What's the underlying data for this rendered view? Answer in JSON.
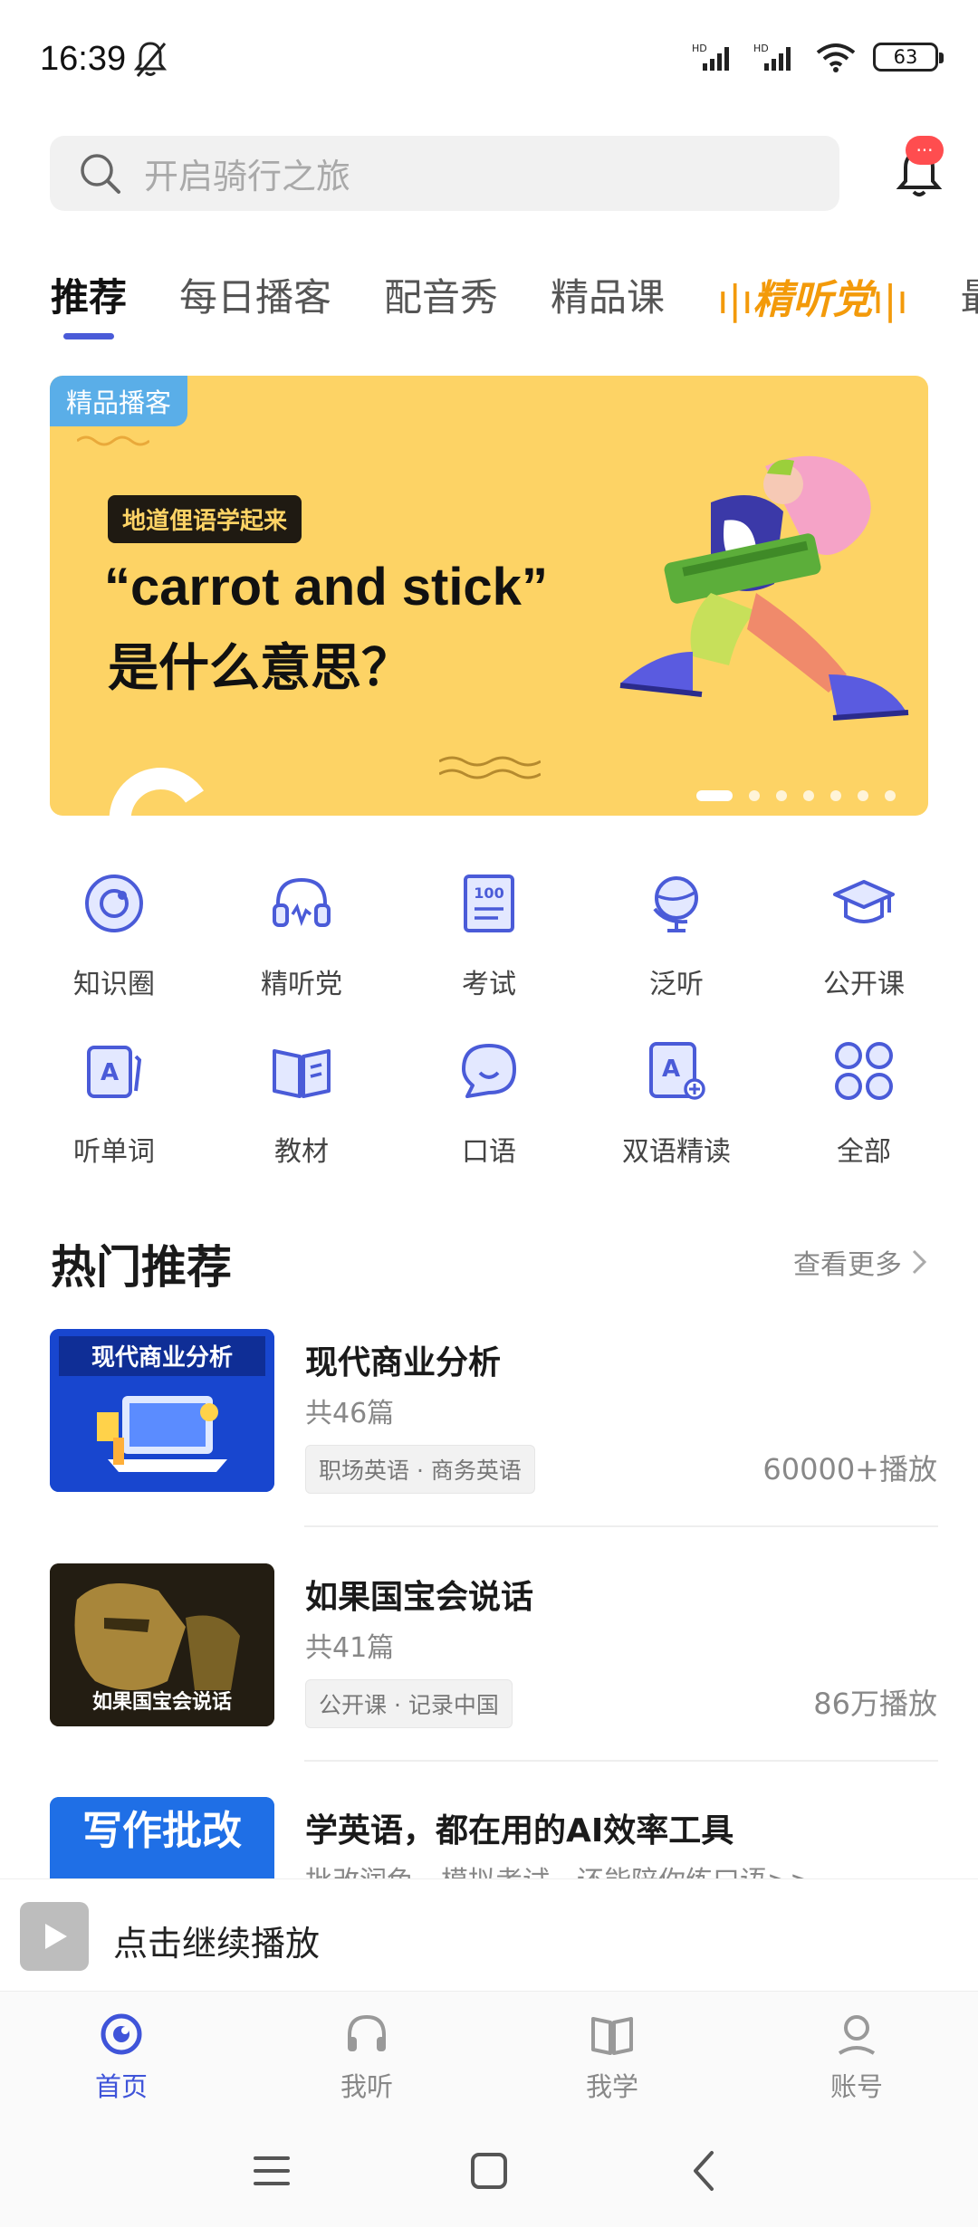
{
  "status": {
    "time": "16:39",
    "battery": "63"
  },
  "search": {
    "placeholder": "开启骑行之旅",
    "badge": "···"
  },
  "tabs": [
    {
      "label": "推荐"
    },
    {
      "label": "每日播客"
    },
    {
      "label": "配音秀"
    },
    {
      "label": "精品课"
    },
    {
      "label": "精听党"
    },
    {
      "label": "最"
    }
  ],
  "banner": {
    "tag": "精品播客",
    "subtitle": "地道俚语学起来",
    "title_line1": "“carrot and stick”",
    "title_line2": "是什么意思？",
    "dot_count": 7,
    "active_dot": 0
  },
  "grid": [
    {
      "label": "知识圈",
      "icon": "knowledge-circle-icon"
    },
    {
      "label": "精听党",
      "icon": "headset-icon"
    },
    {
      "label": "考试",
      "icon": "exam-icon"
    },
    {
      "label": "泛听",
      "icon": "globe-icon"
    },
    {
      "label": "公开课",
      "icon": "graduation-cap-icon"
    },
    {
      "label": "听单词",
      "icon": "word-card-icon"
    },
    {
      "label": "教材",
      "icon": "book-icon"
    },
    {
      "label": "口语",
      "icon": "speech-bubble-icon"
    },
    {
      "label": "双语精读",
      "icon": "bilingual-icon"
    },
    {
      "label": "全部",
      "icon": "all-grid-icon"
    }
  ],
  "section": {
    "title": "热门推荐",
    "more": "查看更多"
  },
  "recommendations": [
    {
      "title": "现代商业分析",
      "count": "共46篇",
      "tags": "职场英语 · 商务英语",
      "plays": "60000+播放",
      "thumb_text": "现代商业分析"
    },
    {
      "title": "如果国宝会说话",
      "count": "共41篇",
      "tags": "公开课 · 记录中国",
      "plays": "86万播放",
      "thumb_text": "如果国宝会说话"
    },
    {
      "title": "学英语，都在用的AI效率工具",
      "desc": "批改润色、模拟考试、还能陪你练口语>>",
      "thumb_text": "写作批改"
    }
  ],
  "player": {
    "text": "点击继续播放"
  },
  "nav": [
    {
      "label": "首页"
    },
    {
      "label": "我听"
    },
    {
      "label": "我学"
    },
    {
      "label": "账号"
    }
  ],
  "colors": {
    "accent": "#3f54d9",
    "banner_bg": "#fdd365",
    "special_tab": "#f39a0a"
  }
}
